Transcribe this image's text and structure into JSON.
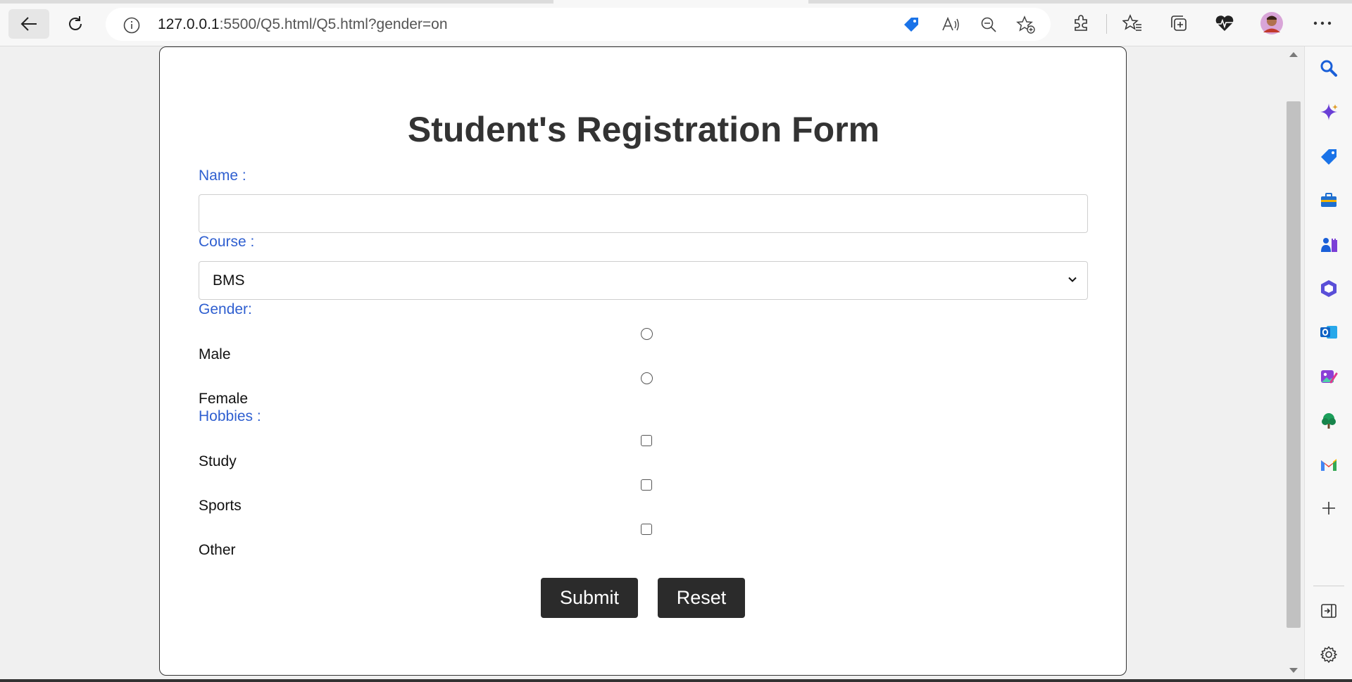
{
  "browser": {
    "url_host": "127.0.0.1",
    "url_rest": ":5500/Q5.html/Q5.html?gender=on",
    "toolbar_icons": [
      "back-icon",
      "reload-icon",
      "site-info-icon",
      "shopping-tag-icon",
      "read-aloud-icon",
      "zoom-out-icon",
      "add-favorite-icon",
      "extensions-icon",
      "favorites-icon",
      "collections-icon",
      "performance-icon",
      "profile-avatar",
      "more-menu-icon"
    ],
    "sidebar_icons": [
      "search-icon",
      "copilot-icon",
      "shopping-icon",
      "tools-icon",
      "games-icon",
      "office-icon",
      "outlook-icon",
      "designer-icon",
      "drop-icon",
      "gmail-icon",
      "add-icon",
      "hide-sidebar-icon",
      "settings-icon"
    ]
  },
  "form": {
    "title": "Student's Registration Form",
    "name_label": "Name :",
    "name_value": "",
    "course_label": "Course :",
    "course_value": "BMS",
    "gender_label": "Gender:",
    "gender_options": [
      "Male",
      "Female"
    ],
    "hobbies_label": "Hobbies :",
    "hobby_options": [
      "Study",
      "Sports",
      "Other"
    ],
    "submit_label": "Submit",
    "reset_label": "Reset"
  },
  "colors": {
    "label_blue": "#2f5fd0",
    "title_text": "#333333",
    "button_bg": "#2b2b2b"
  }
}
